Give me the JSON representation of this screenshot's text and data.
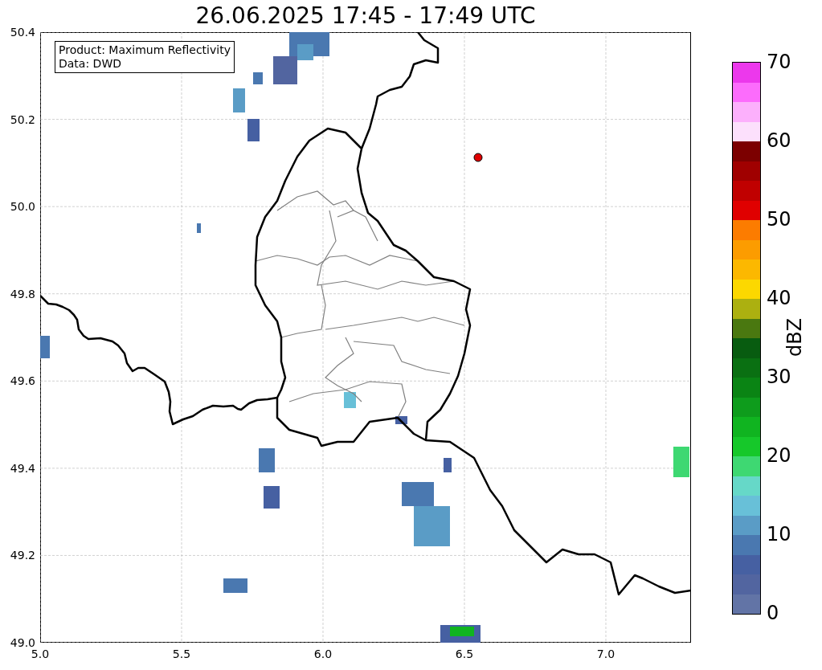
{
  "title": "26.06.2025 17:45 - 17:49 UTC",
  "map": {
    "info_box": [
      "Product: Maximum Reflectivity",
      "Data: DWD"
    ],
    "x_ticks": [
      "5.0",
      "5.5",
      "6.0",
      "6.5",
      "7.0"
    ],
    "y_ticks": [
      "50.4",
      "50.2",
      "50.0",
      "49.8",
      "49.6",
      "49.4",
      "49.2",
      "49.0"
    ]
  },
  "colorbar": {
    "label": "dBZ",
    "ticks": [
      "70",
      "60",
      "50",
      "40",
      "30",
      "20",
      "10",
      "0"
    ],
    "bands": [
      {
        "color": "#6274a6"
      },
      {
        "color": "#5265a0"
      },
      {
        "color": "#4660a2"
      },
      {
        "color": "#4a78b0"
      },
      {
        "color": "#5a9cc6"
      },
      {
        "color": "#68c0d8"
      },
      {
        "color": "#66d8c8"
      },
      {
        "color": "#3ed872"
      },
      {
        "color": "#16c82a"
      },
      {
        "color": "#10b420"
      },
      {
        "color": "#0e9c1c"
      },
      {
        "color": "#0a8414"
      },
      {
        "color": "#0a7012"
      },
      {
        "color": "#085c10"
      },
      {
        "color": "#4a7810"
      },
      {
        "color": "#acb010"
      },
      {
        "color": "#fcd800"
      },
      {
        "color": "#fcb800"
      },
      {
        "color": "#fc9c00"
      },
      {
        "color": "#fc7c00"
      },
      {
        "color": "#e00000"
      },
      {
        "color": "#c00000"
      },
      {
        "color": "#a00000"
      },
      {
        "color": "#7c0000"
      },
      {
        "color": "#fce0fc"
      },
      {
        "color": "#fcb0fc"
      },
      {
        "color": "#fc6cfc"
      },
      {
        "color": "#ec38ec"
      }
    ]
  }
}
